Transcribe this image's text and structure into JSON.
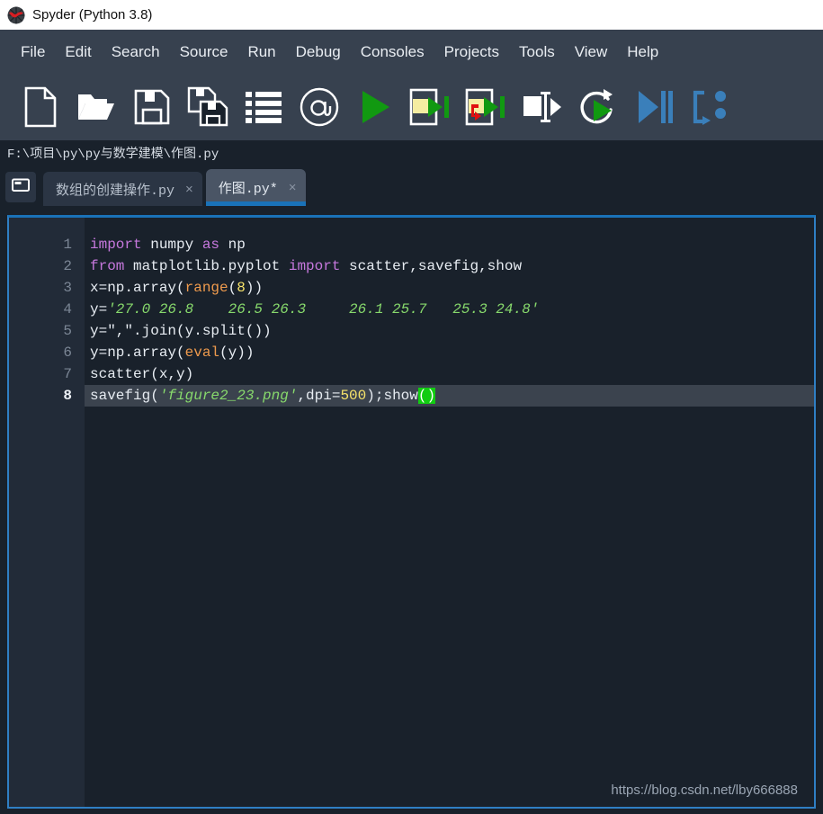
{
  "window": {
    "title": "Spyder (Python 3.8)",
    "logo_icon": "spyder-logo-icon"
  },
  "menubar": {
    "items": [
      {
        "label": "File"
      },
      {
        "label": "Edit"
      },
      {
        "label": "Search"
      },
      {
        "label": "Source"
      },
      {
        "label": "Run"
      },
      {
        "label": "Debug"
      },
      {
        "label": "Consoles"
      },
      {
        "label": "Projects"
      },
      {
        "label": "Tools"
      },
      {
        "label": "View"
      },
      {
        "label": "Help"
      }
    ]
  },
  "toolbar": {
    "items": [
      {
        "name": "new-file-icon",
        "tip": "New file"
      },
      {
        "name": "open-file-icon",
        "tip": "Open file"
      },
      {
        "name": "save-file-icon",
        "tip": "Save file"
      },
      {
        "name": "save-all-icon",
        "tip": "Save all"
      },
      {
        "name": "file-switcher-icon",
        "tip": "File switcher"
      },
      {
        "name": "find-symbol-icon",
        "tip": "Find symbols in file"
      },
      {
        "name": "run-file-icon",
        "tip": "Run file"
      },
      {
        "name": "run-cell-icon",
        "tip": "Run current cell"
      },
      {
        "name": "run-cell-advance-icon",
        "tip": "Run current cell and go to the next one"
      },
      {
        "name": "run-selection-icon",
        "tip": "Run selection or current line"
      },
      {
        "name": "rerun-file-icon",
        "tip": "Re-run last cell"
      },
      {
        "name": "debug-file-icon",
        "tip": "Debug file"
      },
      {
        "name": "configure-run-icon",
        "tip": "Configuration per file"
      }
    ]
  },
  "pathbar": {
    "path": "F:\\项目\\py\\py与数学建模\\作图.py"
  },
  "tabbar": {
    "browse_icon": "folder-icon",
    "tabs": [
      {
        "label": "数组的创建操作.py",
        "close": "×",
        "active": false
      },
      {
        "label": "作图.py*",
        "close": "×",
        "active": true
      }
    ]
  },
  "editor": {
    "line_numbers": [
      "1",
      "2",
      "3",
      "4",
      "5",
      "6",
      "7",
      "8"
    ],
    "current_line": 8,
    "lines": [
      {
        "n": 1,
        "tokens": [
          {
            "t": "import",
            "c": "t-kw"
          },
          {
            "t": " numpy ",
            "c": ""
          },
          {
            "t": "as",
            "c": "t-kw"
          },
          {
            "t": " np",
            "c": ""
          }
        ]
      },
      {
        "n": 2,
        "tokens": [
          {
            "t": "from",
            "c": "t-kw"
          },
          {
            "t": " matplotlib.pyplot ",
            "c": ""
          },
          {
            "t": "import",
            "c": "t-kw"
          },
          {
            "t": " scatter,savefig,show",
            "c": ""
          }
        ]
      },
      {
        "n": 3,
        "tokens": [
          {
            "t": "x=np.array(",
            "c": ""
          },
          {
            "t": "range",
            "c": "t-bi"
          },
          {
            "t": "(",
            "c": ""
          },
          {
            "t": "8",
            "c": "t-num"
          },
          {
            "t": "))",
            "c": ""
          }
        ]
      },
      {
        "n": 4,
        "tokens": [
          {
            "t": "y=",
            "c": ""
          },
          {
            "t": "'27.0 26.8    26.5 26.3     26.1 25.7   25.3 24.8'",
            "c": "t-str"
          }
        ]
      },
      {
        "n": 5,
        "tokens": [
          {
            "t": "y=",
            "c": ""
          },
          {
            "t": "\",\"",
            "c": "t-strn"
          },
          {
            "t": ".join(y.split())",
            "c": ""
          }
        ]
      },
      {
        "n": 6,
        "tokens": [
          {
            "t": "y=np.array(",
            "c": ""
          },
          {
            "t": "eval",
            "c": "t-bi"
          },
          {
            "t": "(y))",
            "c": ""
          }
        ]
      },
      {
        "n": 7,
        "tokens": [
          {
            "t": "scatter(x,y)",
            "c": ""
          }
        ]
      },
      {
        "n": 8,
        "tokens": [
          {
            "t": "savefig(",
            "c": ""
          },
          {
            "t": "'figure2_23.png'",
            "c": "t-str"
          },
          {
            "t": ",dpi=",
            "c": ""
          },
          {
            "t": "500",
            "c": "t-num"
          },
          {
            "t": ");show",
            "c": ""
          },
          {
            "t": "()",
            "c": "t-match"
          }
        ]
      }
    ]
  },
  "watermark": {
    "text": "https://blog.csdn.net/lby666888"
  },
  "colors": {
    "chrome": "#37414f",
    "editor_bg": "#19212b",
    "gutter_bg": "#222b38",
    "accent_blue": "#1a72b8",
    "current_line": "#3b434e",
    "bracket_match": "#11cc11",
    "keyword": "#c678dd",
    "builtin": "#ee9a4d",
    "number": "#f7e36a",
    "string": "#87d96c"
  }
}
